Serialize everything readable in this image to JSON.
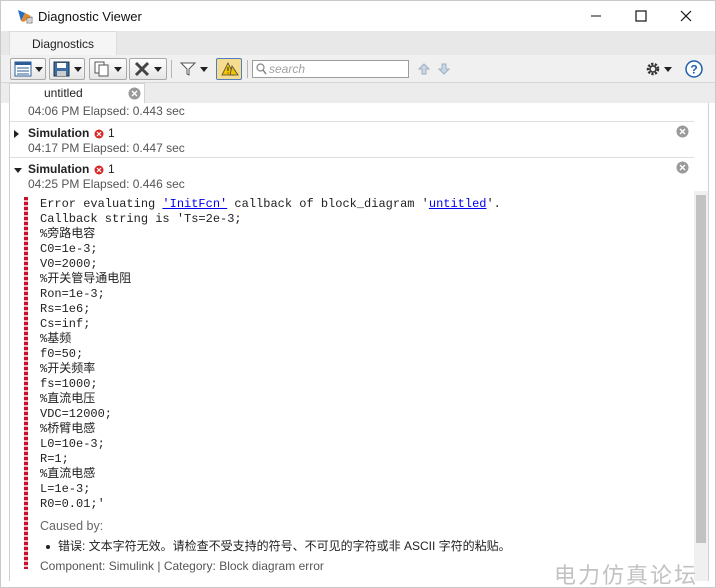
{
  "window": {
    "title": "Diagnostic Viewer",
    "minimize": "—",
    "maximize": "☐",
    "close": "✕"
  },
  "tabs": {
    "diagnostics": "Diagnostics"
  },
  "toolbar": {
    "search_placeholder": "search"
  },
  "document_tab": {
    "label": "untitled"
  },
  "rows": [
    {
      "meta": "04:06 PM   Elapsed: 0.443 sec"
    },
    {
      "title": "Simulation",
      "error_count": "1",
      "meta": "04:17 PM   Elapsed: 0.447 sec",
      "expanded": false
    },
    {
      "title": "Simulation",
      "error_count": "1",
      "meta": "04:25 PM   Elapsed: 0.446 sec",
      "expanded": true
    }
  ],
  "detail": {
    "line1_prefix": "Error evaluating ",
    "line1_link1": "'InitFcn'",
    "line1_middle": " callback of block_diagram '",
    "line1_link2": "untitled",
    "line1_suffix": "'.",
    "code_lines": [
      "Callback string is 'Ts=2e-3;",
      "%旁路电容",
      "C0=1e-3;",
      "V0=2000;",
      "%开关管导通电阻",
      "Ron=1e-3;",
      "Rs=1e6;",
      "Cs=inf;",
      "%基频",
      "f0=50;",
      "%开关频率",
      "fs=1000;",
      "%直流电压",
      "VDC=12000;",
      "%桥臂电感",
      "L0=10e-3;",
      "R=1;",
      "%直流电感",
      "L=1e-3;",
      "R0=0.01;'"
    ],
    "caused_by": "Caused by:",
    "cause_text": "错误: 文本字符无效。请检查不受支持的符号、不可见的字符或非 ASCII 字符的粘贴。",
    "component": "Component:  Simulink | Category:  Block diagram error"
  },
  "watermark": "电力仿真论坛",
  "colors": {
    "error": "#d62a2a",
    "link": "#0000ee",
    "accent": "#1f6fc5"
  }
}
